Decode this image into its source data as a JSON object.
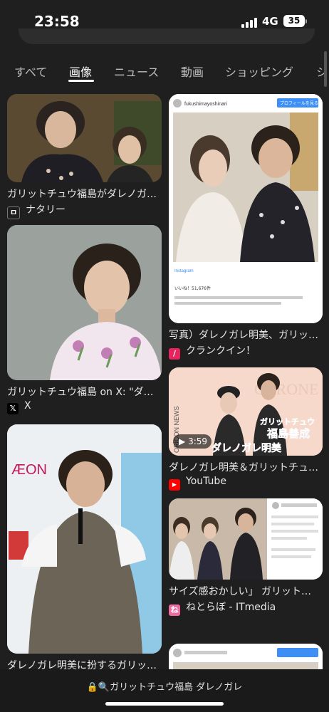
{
  "status_bar": {
    "time": "23:58",
    "network": "4G",
    "battery": "35"
  },
  "tabs": [
    {
      "label": "すべて"
    },
    {
      "label": "画像"
    },
    {
      "label": "ニュース"
    },
    {
      "label": "動画"
    },
    {
      "label": "ショッピング"
    },
    {
      "label": "シ"
    }
  ],
  "active_tab": "画像",
  "results": [
    {
      "caption": "ガリットチュウ福島がダレノガ…",
      "source": "ナタリー",
      "favicon": "natalie-icon"
    },
    {
      "caption": "ガリットチュウ福島 on X: \"ダ…",
      "source": "X",
      "favicon": "x-icon"
    },
    {
      "caption": "ダレノガレ明美に扮するガリッ…",
      "source": "",
      "favicon": ""
    },
    {
      "caption": "写真）ダレノガレ明美、ガリッ…",
      "source": "クランクイン！",
      "favicon": "crankin-icon"
    },
    {
      "caption": "ダレノガレ明美＆ガリットチュ…",
      "source": "YouTube",
      "favicon": "youtube-icon",
      "duration": "3:59"
    },
    {
      "caption": "サイズ感おかしい」 ガリット…",
      "source": "ねとらぼ - ITmedia",
      "favicon": "netorabo-icon"
    }
  ],
  "image_text": {
    "insta_user": "fukushimayoshinari",
    "insta_button": "プロフィールを見る",
    "insta_likes": "いいね！51,676件",
    "oricon_label": "ORICON NEWS",
    "overlay_name_1": "ガリットチュウ",
    "overlay_name_2": "福島善成",
    "overlay_name_3": "ダレノガレ明美",
    "aeon": "ÆON"
  },
  "bottom_bar": {
    "query": "ガリットチュウ福島 ダレノガレ"
  },
  "colors": {
    "background": "#1f1f1f",
    "youtube": "#ff0000",
    "crankin": "#e8245e",
    "netorabo": "#f06ba0"
  }
}
